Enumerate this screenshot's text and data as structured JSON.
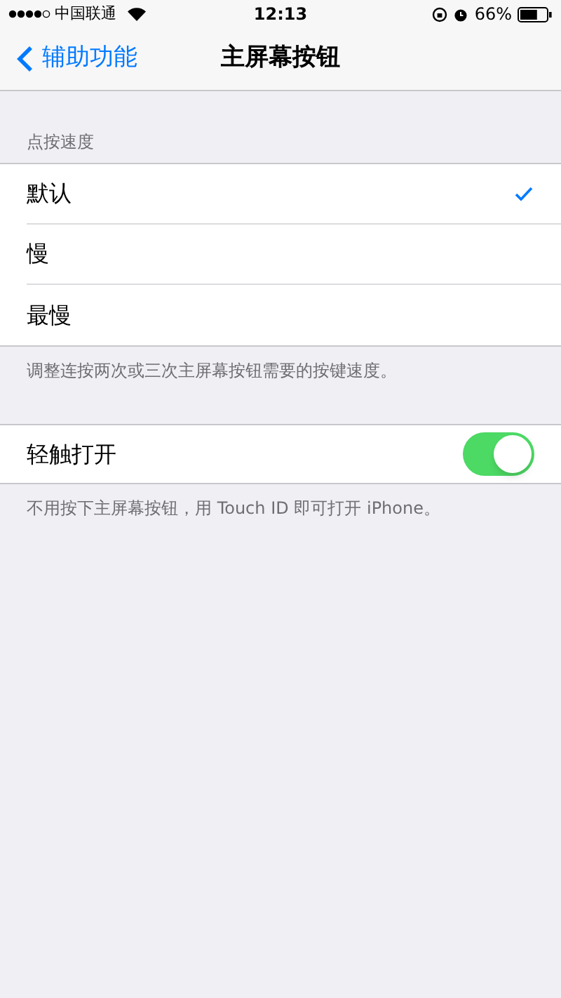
{
  "status_bar": {
    "carrier": "中国联通",
    "time": "12:13",
    "battery": "66%"
  },
  "nav": {
    "back": "辅助功能",
    "title": "主屏幕按钮"
  },
  "speed_section": {
    "header": "点按速度",
    "options": [
      {
        "label": "默认",
        "selected": true
      },
      {
        "label": "慢",
        "selected": false
      },
      {
        "label": "最慢",
        "selected": false
      }
    ],
    "footer": "调整连按两次或三次主屏幕按钮需要的按键速度。"
  },
  "touch_section": {
    "label": "轻触打开",
    "on": true,
    "footer": "不用按下主屏幕按钮，用 Touch ID 即可打开 iPhone。"
  }
}
